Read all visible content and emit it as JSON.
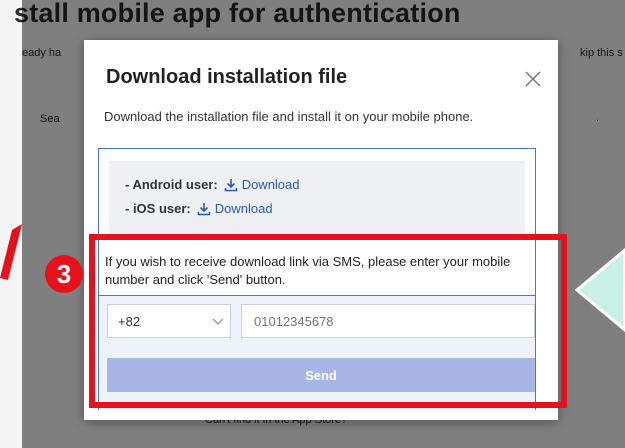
{
  "background": {
    "heading": "stall mobile app for authentication",
    "left_fragment_1": "eady ha",
    "right_fragment_1": "kip this s",
    "left_fragment_2": "Sea",
    "right_fragment_2": ".",
    "bottom_link": "Can't find it in the App Store?"
  },
  "modal": {
    "title": "Download installation file",
    "description": "Download the installation file and install it on your mobile phone.",
    "android": {
      "label": "- Android user:",
      "link": "Download"
    },
    "ios": {
      "label": "- iOS user:",
      "link": "Download"
    },
    "sms_instruction": "If you wish to receive download link via SMS, please enter your mobile number and click 'Send' button.",
    "country_code": "+82",
    "phone_placeholder": "01012345678",
    "send_label": "Send"
  },
  "annotation": {
    "step_number": "3",
    "accent_color": "#e8111b"
  },
  "colors": {
    "link": "#2b57c2",
    "send_button": "#a7b6e4"
  }
}
